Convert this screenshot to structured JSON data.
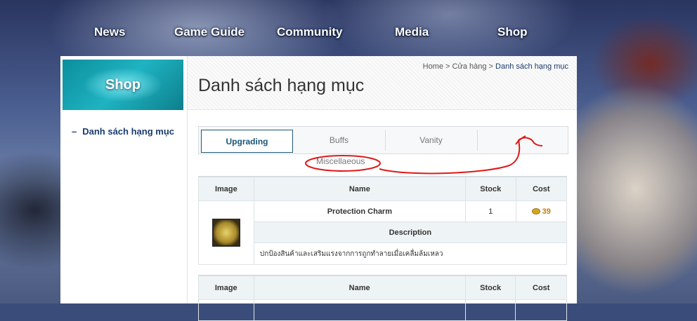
{
  "nav": {
    "items": [
      "News",
      "Game Guide",
      "Community",
      "Media",
      "Shop"
    ]
  },
  "sidebar": {
    "banner": "Shop",
    "link": "Danh sách hạng mục"
  },
  "breadcrumb": {
    "home": "Home",
    "sep": ">",
    "shop": "Cửa hàng",
    "current": "Danh sách hạng mục"
  },
  "page": {
    "title": "Danh sách hạng mục"
  },
  "tabs": {
    "items": [
      "Upgrading",
      "Buffs",
      "Vanity",
      "Miscellaeous"
    ],
    "active": "Upgrading"
  },
  "table": {
    "headers": {
      "image": "Image",
      "name": "Name",
      "stock": "Stock",
      "cost": "Cost",
      "description": "Description"
    },
    "items": [
      {
        "name": "Protection Charm",
        "stock": "1",
        "cost": "39",
        "description": "ปกป้องสินค้าและเสริมแรงจากการถูกทำลายเมื่อเคลื่มล้มเหลว"
      }
    ]
  },
  "colors": {
    "accent": "#1a3b6e",
    "banner": "#1fb3c2",
    "annotation": "#e01818",
    "cost": "#c47b00"
  }
}
